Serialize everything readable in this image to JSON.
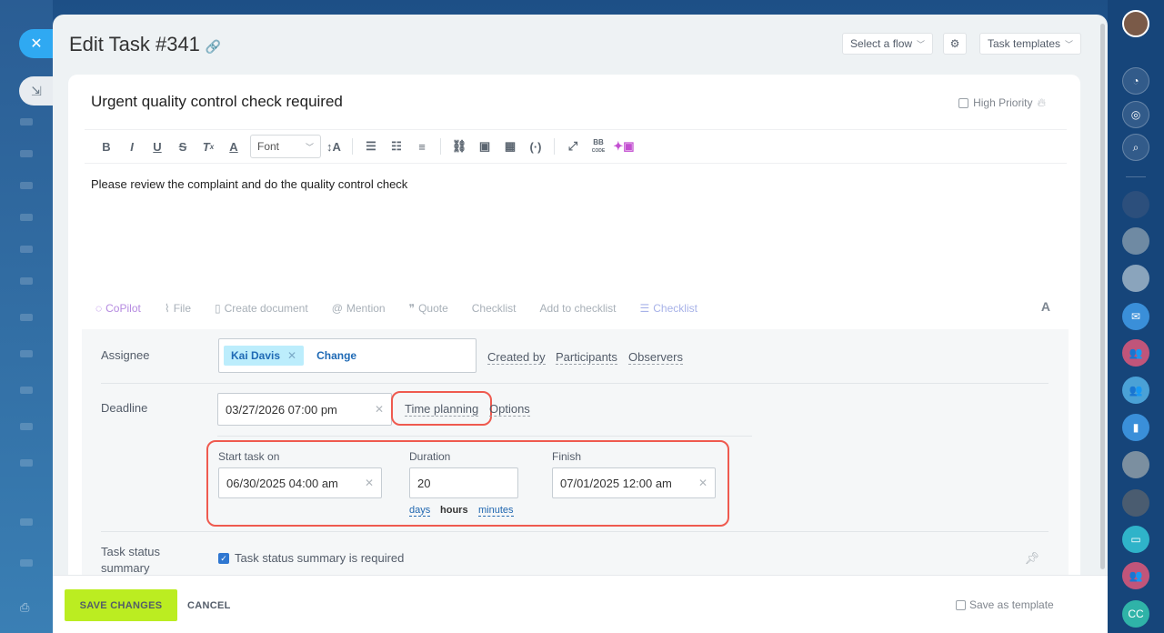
{
  "header": {
    "title": "Edit Task #341",
    "select_flow": "Select a flow",
    "task_templates": "Task templates"
  },
  "task": {
    "title": "Urgent quality control check required",
    "high_priority_label": "High Priority",
    "description": "Please review the complaint and do the quality control check"
  },
  "toolbar": {
    "font_label": "Font",
    "bbcode_line1": "BB",
    "bbcode_line2": "CODE"
  },
  "actions": {
    "copilot": "CoPilot",
    "file": "File",
    "create_document": "Create document",
    "mention": "Mention",
    "quote": "Quote",
    "checklist": "Checklist",
    "add_to_checklist": "Add to checklist",
    "checklist2": "Checklist",
    "text_format": "A"
  },
  "assignee": {
    "label": "Assignee",
    "name": "Kai Davis",
    "change": "Change",
    "created_by": "Created by",
    "participants": "Participants",
    "observers": "Observers"
  },
  "deadline": {
    "label": "Deadline",
    "value": "03/27/2026 07:00 pm",
    "time_planning": "Time planning",
    "options": "Options"
  },
  "planning": {
    "start_label": "Start task on",
    "start_value": "06/30/2025 04:00 am",
    "duration_label": "Duration",
    "duration_value": "20",
    "finish_label": "Finish",
    "finish_value": "07/01/2025 12:00 am",
    "units": [
      "days",
      "hours",
      "minutes"
    ],
    "active_unit": "hours"
  },
  "status_summary": {
    "label_line1": "Task status",
    "label_line2": "summary",
    "checkbox_label": "Task status summary is required"
  },
  "footer": {
    "save": "SAVE CHANGES",
    "cancel": "CANCEL",
    "save_template": "Save as template"
  },
  "sidebar": {
    "cc_label": "CC"
  },
  "colors": {
    "accent": "#2fa9f2",
    "save_button": "#bbed21",
    "highlight": "#ef5a4f",
    "link": "#1f6ab5"
  }
}
